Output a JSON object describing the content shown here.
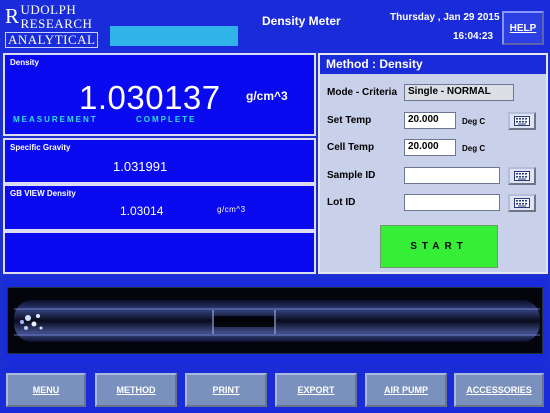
{
  "header": {
    "logo_line1": "UDOLPH",
    "logo_line2": "RESEARCH",
    "logo_line3": "ANALYTICAL",
    "logo_letter": "R",
    "app_title": "Density Meter",
    "date": "Thursday , Jan 29 2015",
    "time": "16:04:23",
    "help_label": "HELP"
  },
  "density": {
    "label": "Density",
    "value": "1.030137",
    "unit": "g/cm^3",
    "status_word1": "MEASUREMENT",
    "status_word2": "COMPLETE"
  },
  "specific_gravity": {
    "label": "Specific Gravity",
    "value": "1.031991"
  },
  "gb_view": {
    "label": "GB VIEW Density",
    "value": "1.03014",
    "unit": "g/cm^3"
  },
  "method": {
    "title": "Method : Density",
    "mode_label": "Mode - Criteria",
    "mode_value": "Single - NORMAL",
    "set_temp_label": "Set Temp",
    "set_temp_value": "20.000",
    "set_temp_unit": "Deg C",
    "cell_temp_label": "Cell Temp",
    "cell_temp_value": "20.000",
    "cell_temp_unit": "Deg C",
    "sample_id_label": "Sample ID",
    "sample_id_value": "",
    "lot_id_label": "Lot ID",
    "lot_id_value": "",
    "start_label": "START"
  },
  "nav": [
    {
      "label": "MENU"
    },
    {
      "label": "METHOD"
    },
    {
      "label": "PRINT"
    },
    {
      "label": "EXPORT"
    },
    {
      "label": "AIR PUMP"
    },
    {
      "label": "ACCESSORIES"
    }
  ],
  "colors": {
    "background": "#1a2bd9",
    "panel": "#0a0af0",
    "status_text": "#2ce0e0",
    "start_button": "#37ee37",
    "method_panel": "#c9d0ea",
    "nav_button": "#7a91bd"
  },
  "icons": [
    "keyboard-icon"
  ]
}
